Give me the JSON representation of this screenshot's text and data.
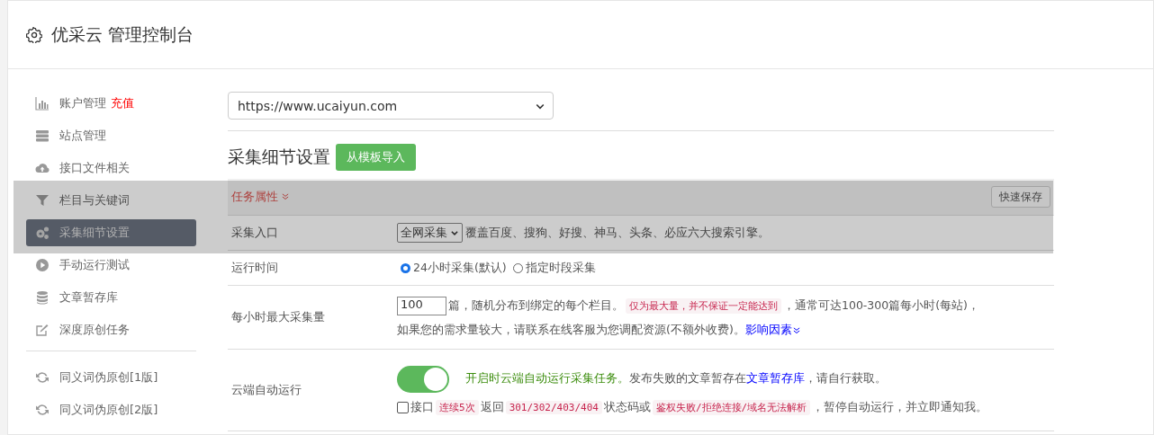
{
  "header": {
    "title": "优采云 管理控制台"
  },
  "sidebar": {
    "items": [
      {
        "kind": "item",
        "label": "账户管理",
        "badge": "充值",
        "selected": false
      },
      {
        "kind": "item",
        "label": "站点管理",
        "selected": false
      },
      {
        "kind": "item",
        "label": "接口文件相关",
        "selected": false
      },
      {
        "kind": "item",
        "label": "栏目与关键词",
        "selected": false
      },
      {
        "kind": "item",
        "label": "采集细节设置",
        "selected": true
      },
      {
        "kind": "item",
        "label": "手动运行测试",
        "selected": false
      },
      {
        "kind": "item",
        "label": "文章暂存库",
        "selected": false
      },
      {
        "kind": "item",
        "label": "深度原创任务",
        "selected": false
      },
      {
        "kind": "divider"
      },
      {
        "kind": "item",
        "label": "同义词伪原创[1版]",
        "selected": false
      },
      {
        "kind": "item",
        "label": "同义词伪原创[2版]",
        "selected": false
      }
    ]
  },
  "site_select": {
    "value": "https://www.ucaiyun.com"
  },
  "section": {
    "title": "采集细节设置",
    "import_button": "从模板导入"
  },
  "settings": {
    "header": "任务属性",
    "save_button": "快速保存",
    "rows": [
      {
        "kind": "select",
        "label": "采集入口",
        "value": "全网采集",
        "note": "覆盖百度、搜狗、好搜、神马、头条、必应六大搜索引擎。"
      },
      {
        "kind": "radios",
        "label": "运行时间",
        "options": [
          {
            "label": "24小时采集(默认)",
            "selected": true
          },
          {
            "label": "指定时段采集",
            "selected": false
          }
        ]
      },
      {
        "kind": "amount",
        "label": "每小时最大采集量",
        "value": "100",
        "text1": "篇，随机分布到绑定的每个栏目。",
        "tag": "仅为最大量，并不保证一定能达到",
        "text2": "，通常可达100-300篇每小时(每站)，",
        "text3": "如果您的需求量较大，请联系在线客服为您调配资源(不额外收费)。",
        "link": "影响因素"
      },
      {
        "kind": "auto",
        "label": "云端自动运行",
        "on": true,
        "green_text": "开启时云端自动运行采集任务。",
        "text1": "发布失败的文章暂存在",
        "link": "文章暂存库",
        "text2": "，请自行获取。",
        "checked": false,
        "parts": [
          {
            "code": false,
            "text": "接口"
          },
          {
            "code": true,
            "text": "连续5次"
          },
          {
            "code": false,
            "text": "返回"
          },
          {
            "code": true,
            "text": "301/302/403/404"
          },
          {
            "code": false,
            "text": "状态码或"
          },
          {
            "code": true,
            "text": "鉴权失败/拒绝连接/域名无法解析"
          },
          {
            "code": false,
            "text": "，暂停自动运行，并立即通知我。"
          }
        ]
      }
    ]
  }
}
